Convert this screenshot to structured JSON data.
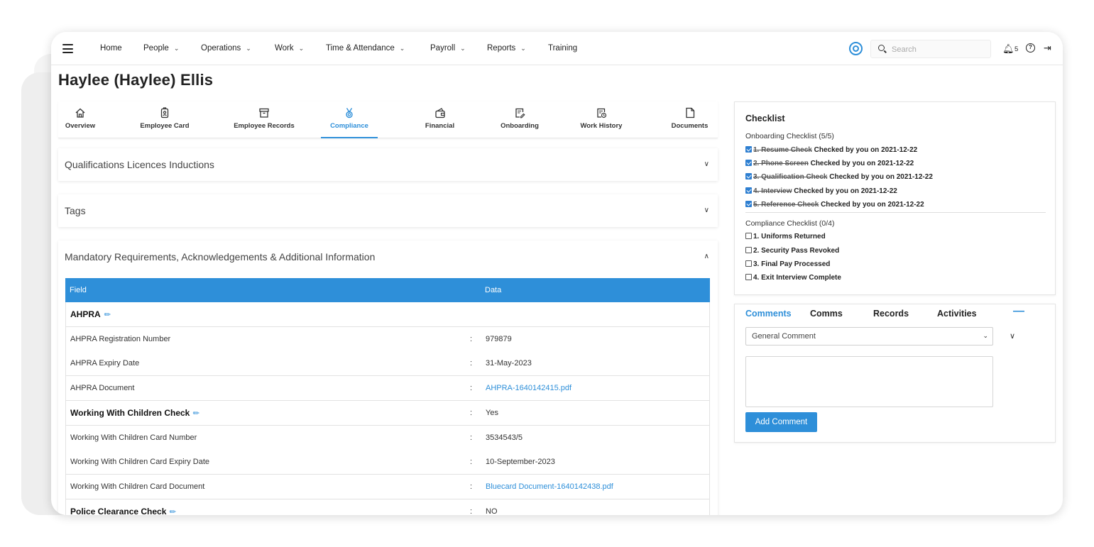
{
  "nav": {
    "items": [
      {
        "label": "Home",
        "dropdown": false
      },
      {
        "label": "People",
        "dropdown": true
      },
      {
        "label": "Operations",
        "dropdown": true
      },
      {
        "label": "Work",
        "dropdown": true
      },
      {
        "label": "Time & Attendance",
        "dropdown": true
      },
      {
        "label": "Payroll",
        "dropdown": true
      },
      {
        "label": "Reports",
        "dropdown": true
      },
      {
        "label": "Training",
        "dropdown": false
      }
    ],
    "search_placeholder": "Search",
    "notification_count": "5",
    "chevron": "⌄"
  },
  "page": {
    "title": "Haylee (Haylee) Ellis"
  },
  "tabs": [
    {
      "label": "Overview",
      "icon": "home-icon",
      "active": false
    },
    {
      "label": "Employee Card",
      "icon": "id-badge-icon",
      "active": false
    },
    {
      "label": "Employee Records",
      "icon": "archive-box-icon",
      "active": false
    },
    {
      "label": "Compliance",
      "icon": "medal-icon",
      "active": true
    },
    {
      "label": "Financial",
      "icon": "wallet-icon",
      "active": false
    },
    {
      "label": "Onboarding",
      "icon": "edit-document-icon",
      "active": false
    },
    {
      "label": "Work History",
      "icon": "history-document-icon",
      "active": false
    },
    {
      "label": "Documents",
      "icon": "document-icon",
      "active": false
    }
  ],
  "sections": {
    "qualifications": {
      "title": "Qualifications Licences Inductions",
      "expanded": false
    },
    "tags": {
      "title": "Tags",
      "expanded": false
    },
    "mandatory": {
      "title": "Mandatory Requirements, Acknowledgements & Additional Information",
      "expanded": true
    }
  },
  "table": {
    "headers": {
      "field": "Field",
      "data": "Data"
    },
    "rows": [
      {
        "field": "AHPRA",
        "group": true,
        "editable": true,
        "value": "",
        "link": false
      },
      {
        "field": "AHPRA Registration Number",
        "group": false,
        "editable": false,
        "value": "979879",
        "link": false
      },
      {
        "field": "AHPRA Expiry Date",
        "group": false,
        "editable": false,
        "value": "31-May-2023",
        "link": false
      },
      {
        "field": "AHPRA Document",
        "group": false,
        "editable": false,
        "value": "AHPRA-1640142415.pdf",
        "link": true
      },
      {
        "field": "Working With Children Check",
        "group": true,
        "editable": true,
        "value": "Yes",
        "link": false
      },
      {
        "field": "Working With Children Card Number",
        "group": false,
        "editable": false,
        "value": "3534543/5",
        "link": false
      },
      {
        "field": "Working With Children Card Expiry Date",
        "group": false,
        "editable": false,
        "value": "10-September-2023",
        "link": false
      },
      {
        "field": "Working With Children Card Document",
        "group": false,
        "editable": false,
        "value": "Bluecard Document-1640142438.pdf",
        "link": true
      },
      {
        "field": "Police Clearance Check",
        "group": true,
        "editable": true,
        "value": "NO",
        "link": false
      }
    ]
  },
  "checklist": {
    "title": "Checklist",
    "onboarding_title": "Onboarding Checklist (5/5)",
    "onboarding_items": [
      {
        "name": "1. Resume Check",
        "checked": true,
        "note": "Checked by you on 2021-12-22"
      },
      {
        "name": "2. Phone Screen",
        "checked": true,
        "note": "Checked by you on 2021-12-22"
      },
      {
        "name": "3. Qualification Check",
        "checked": true,
        "note": "Checked by you on 2021-12-22"
      },
      {
        "name": "4. Interview",
        "checked": true,
        "note": "Checked by you on 2021-12-22"
      },
      {
        "name": "5. Reference Check",
        "checked": true,
        "note": "Checked by you on 2021-12-22"
      }
    ],
    "compliance_title": "Compliance Checklist (0/4)",
    "compliance_items": [
      {
        "name": "1. Uniforms Returned",
        "checked": false
      },
      {
        "name": "2. Security Pass Revoked",
        "checked": false
      },
      {
        "name": "3. Final Pay Processed",
        "checked": false
      },
      {
        "name": "4. Exit Interview Complete",
        "checked": false
      }
    ]
  },
  "comments": {
    "tabs": [
      "Comments",
      "Comms",
      "Records",
      "Activities"
    ],
    "collapse_symbol": "—",
    "type_selected": "General Comment",
    "comment_value": "",
    "add_button": "Add Comment"
  },
  "colors": {
    "accent": "#2e8fd9"
  }
}
